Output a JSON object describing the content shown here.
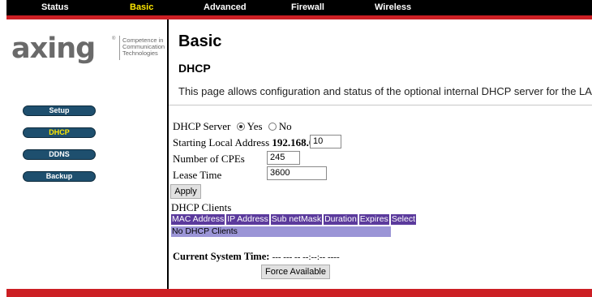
{
  "nav": {
    "items": [
      {
        "label": "Status"
      },
      {
        "label": "Basic"
      },
      {
        "label": "Advanced"
      },
      {
        "label": "Firewall"
      },
      {
        "label": "Wireless"
      }
    ],
    "active": "Basic"
  },
  "logo": {
    "word": "axing",
    "registered": "®",
    "tagline": [
      "Competence in",
      "Communication",
      "Technologies"
    ]
  },
  "sidebar": {
    "items": [
      {
        "label": "Setup"
      },
      {
        "label": "DHCP"
      },
      {
        "label": "DDNS"
      },
      {
        "label": "Backup"
      }
    ],
    "active": "DHCP"
  },
  "page": {
    "title": "Basic",
    "subtitle": "DHCP",
    "description": "This page allows configuration and status of the optional internal DHCP server for the LAN."
  },
  "form": {
    "dhcp_server_label": "DHCP Server",
    "dhcp_server_options": [
      "Yes",
      "No"
    ],
    "dhcp_server_selected": "Yes",
    "start_address_label": "Starting Local Address",
    "start_address_prefix": "192.168.0.",
    "start_address_value": "10",
    "num_cpes_label": "Number of CPEs",
    "num_cpes_value": "245",
    "lease_time_label": "Lease Time",
    "lease_time_value": "3600",
    "apply_label": "Apply"
  },
  "clients": {
    "title": "DHCP Clients",
    "columns": [
      "MAC Address",
      "IP Address",
      "Sub netMask",
      "Duration",
      "Expires",
      "Select"
    ],
    "empty_text": "No DHCP Clients"
  },
  "system_time": {
    "label": "Current System Time:",
    "value": "--- --- -- --:--:-- ----"
  },
  "force_available_label": "Force Available",
  "colors": {
    "nav_bg": "#000000",
    "accent_red": "#cc1f24",
    "active_text": "#ffe800",
    "sidebar_button": "#1e4f6e",
    "table_header": "#5b3a9c",
    "table_row": "#9b95d6"
  }
}
